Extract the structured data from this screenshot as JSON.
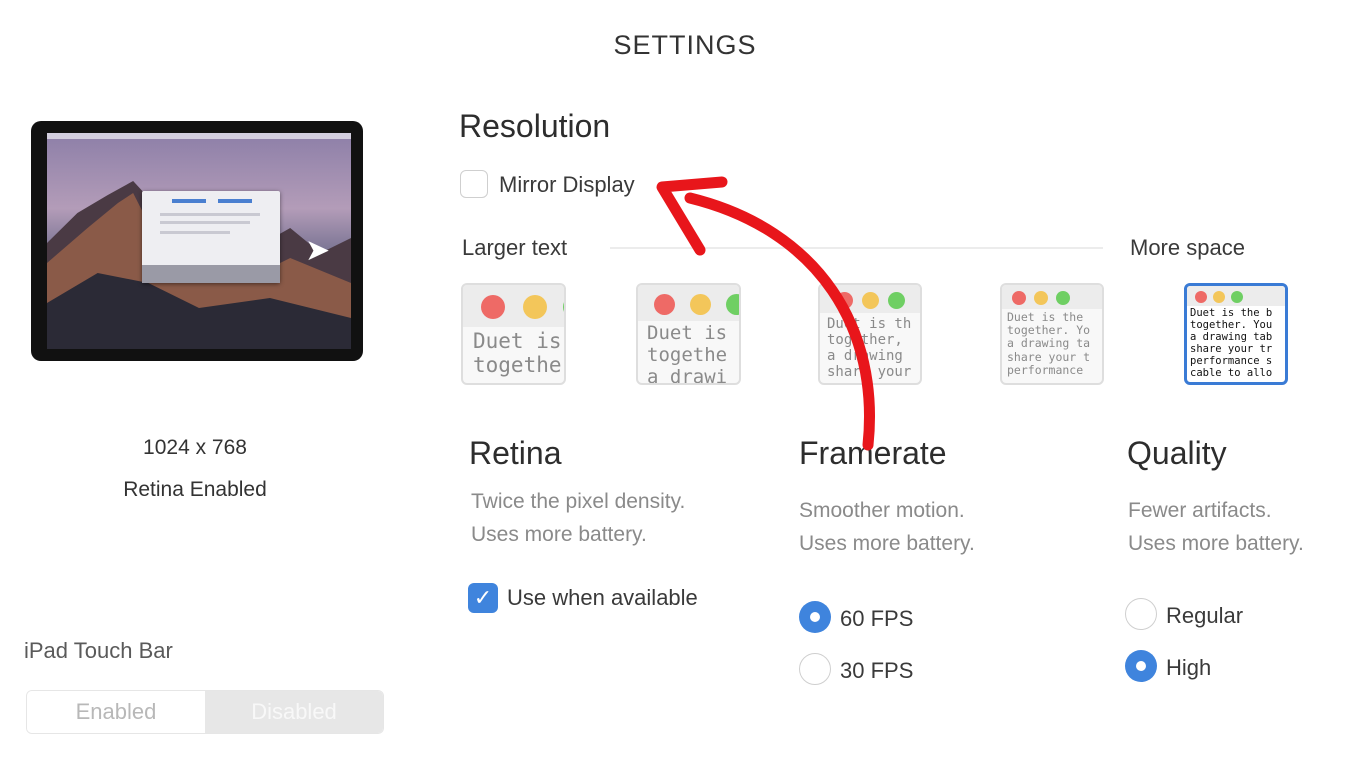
{
  "header": {
    "title": "SETTINGS"
  },
  "preview": {
    "resolution_text": "1024 x 768",
    "retina_status": "Retina Enabled"
  },
  "touch_bar": {
    "label": "iPad Touch Bar",
    "options": [
      "Enabled",
      "Disabled"
    ],
    "selected": "Disabled"
  },
  "resolution": {
    "heading": "Resolution",
    "mirror_label": "Mirror Display",
    "mirror_checked": false,
    "scale_left": "Larger text",
    "scale_right": "More space",
    "selected_index": 4,
    "thumbnails": [
      {
        "text": "Duet is\ntogethe"
      },
      {
        "text": "Duet is\ntogethe\na drawi"
      },
      {
        "text": "Duet is th\ntogether, \na drawing \nshare your"
      },
      {
        "text": "Duet is the\ntogether. Yo\na drawing ta\nshare your t\nperformance"
      },
      {
        "text": "Duet is the b\ntogether. You\na drawing tab\nshare your tr\nperformance s\ncable to allo"
      }
    ]
  },
  "retina": {
    "heading": "Retina",
    "desc_line1": "Twice the pixel density.",
    "desc_line2": "Uses more battery.",
    "option_label": "Use when available",
    "option_checked": true
  },
  "framerate": {
    "heading": "Framerate",
    "desc_line1": "Smoother motion.",
    "desc_line2": "Uses more battery.",
    "options": [
      "60 FPS",
      "30 FPS"
    ],
    "selected": "60 FPS"
  },
  "quality": {
    "heading": "Quality",
    "desc_line1": "Fewer artifacts.",
    "desc_line2": "Uses more battery.",
    "options": [
      "Regular",
      "High"
    ],
    "selected": "High"
  },
  "colors": {
    "accent": "#3f84dd",
    "annotation_arrow": "#e8161b",
    "traffic_red": "#ee6a66",
    "traffic_yellow": "#f3c65a",
    "traffic_green": "#6fcf63"
  }
}
